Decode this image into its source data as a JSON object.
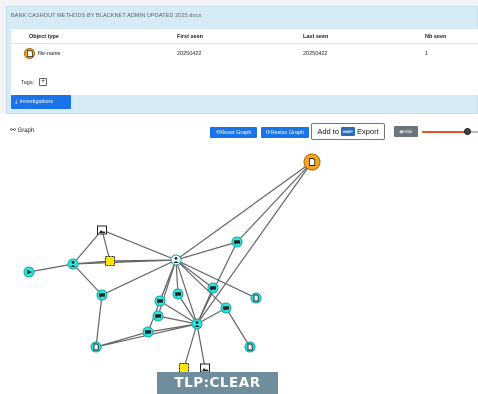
{
  "file_title": "BANK CASHOUT METHODS BY BLACKNET ADMIN UPDATED 2025.docx",
  "table": {
    "headers": [
      "Object type",
      "First seen",
      "Last seen",
      "Nb seen"
    ],
    "row": {
      "type": "file-name",
      "first_seen": "20250422",
      "last_seen": "20250422",
      "nb_seen": "1"
    }
  },
  "tags": {
    "label": "Tags:",
    "add_symbol": "+"
  },
  "investigations_button": "Investigations",
  "graph": {
    "label": "Graph",
    "reset_button": "Reset Graph",
    "resize_button": "Resize Graph",
    "misp_prefix": "Add to",
    "misp_logo": "MISP",
    "export_label": "Export",
    "hide_button": "Hide",
    "slider_value": 0.76
  },
  "tlp": "TLP:CLEAR",
  "colors": {
    "accent": "#1a73e8",
    "node_cyan": "#2ee6e0",
    "node_orange": "#f5a623",
    "node_yellow": "#ffe600",
    "tlp": "#6f8d9c"
  }
}
